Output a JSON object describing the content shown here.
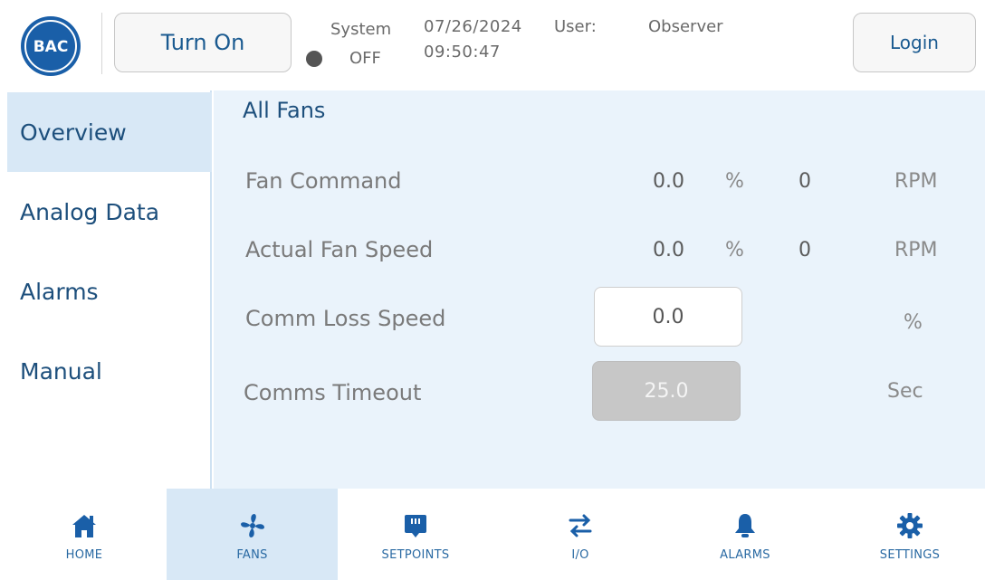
{
  "header": {
    "logo_text": "BAC",
    "turn_on_label": "Turn On",
    "system_label": "System",
    "system_state": "OFF",
    "date": "07/26/2024",
    "time": "09:50:47",
    "user_label": "User:",
    "user_name": "Observer",
    "login_label": "Login"
  },
  "sidebar": {
    "items": [
      {
        "label": "Overview"
      },
      {
        "label": "Analog Data"
      },
      {
        "label": "Alarms"
      },
      {
        "label": "Manual"
      }
    ]
  },
  "main": {
    "title": "All Fans",
    "fan_command": {
      "label": "Fan Command",
      "percent": "0.0",
      "percent_unit": "%",
      "rpm": "0",
      "rpm_unit": "RPM"
    },
    "actual_fan_speed": {
      "label": "Actual Fan Speed",
      "percent": "0.0",
      "percent_unit": "%",
      "rpm": "0",
      "rpm_unit": "RPM"
    },
    "comm_loss_speed": {
      "label": "Comm Loss Speed",
      "value": "0.0",
      "unit": "%"
    },
    "comms_timeout": {
      "label": "Comms Timeout",
      "value": "25.0",
      "unit": "Sec"
    }
  },
  "bottom_nav": {
    "items": [
      {
        "label": "HOME",
        "icon": "home-icon"
      },
      {
        "label": "FANS",
        "icon": "fan-icon"
      },
      {
        "label": "SETPOINTS",
        "icon": "setpoints-icon"
      },
      {
        "label": "I/O",
        "icon": "io-icon"
      },
      {
        "label": "ALARMS",
        "icon": "bell-icon"
      },
      {
        "label": "SETTINGS",
        "icon": "gear-icon"
      }
    ]
  },
  "colors": {
    "brand_blue": "#1a5fa8",
    "nav_active_bg": "#d8e8f6",
    "panel_bg": "#eaf3fb",
    "status_dot": "#555555"
  }
}
